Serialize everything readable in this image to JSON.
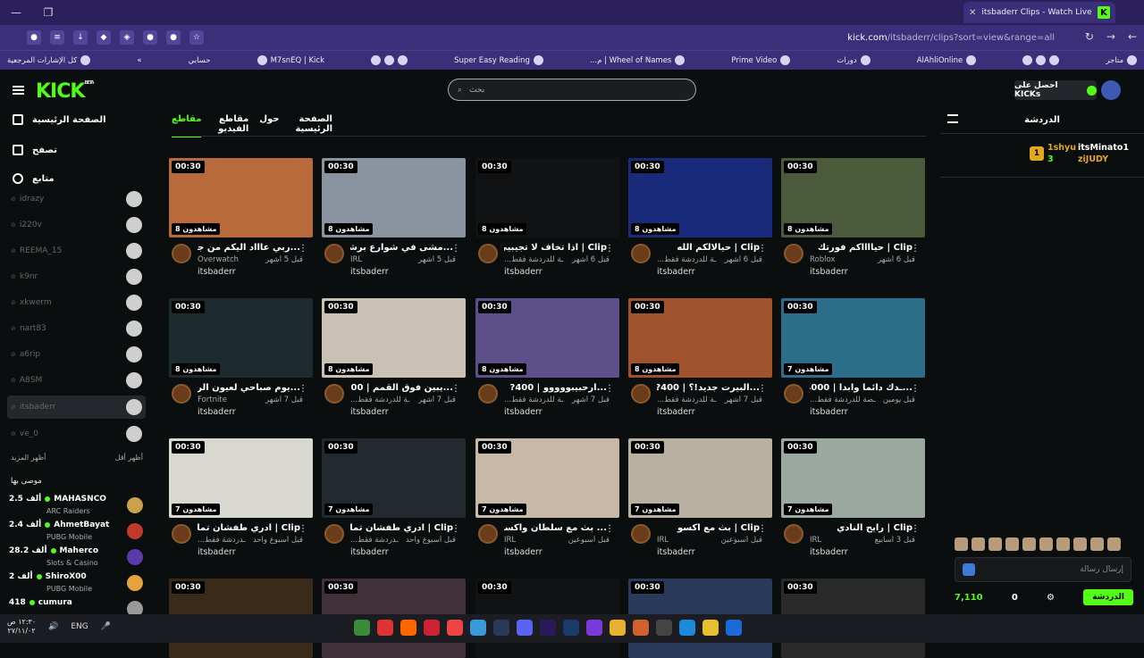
{
  "browser": {
    "tab_title": "itsbaderr Clips - Watch Live on",
    "url_main": "kick.com",
    "url_path": "/itsbaderr/clips?sort=view&range=all",
    "bookmarks": [
      "كل الإشارات المرجعية",
      "حسابي",
      "M7snEQ | Kick",
      "Super Easy Reading",
      "Wheel of Names | م...",
      "Prime Video",
      "دورات",
      "AlAhliOnline",
      "متاجر"
    ]
  },
  "header": {
    "search_placeholder": "بحث",
    "kicks_button": "احصل على KICKs",
    "logo": "KICK",
    "logo_beta": "BETA"
  },
  "sidebar": {
    "home": "الصفحة الرئيسية",
    "browse": "تصفح",
    "following": "متابع",
    "followed": [
      "idrazy",
      "i220v",
      "REEMA_15",
      "k9nr",
      "xkwerm",
      "nart83",
      "a6rip",
      "A8SM",
      "itsbaderr",
      "ve_0"
    ],
    "show_more": "أظهر المزيد",
    "show_less": "أظهر أقل",
    "recommended_title": "موصى بها",
    "recommended": [
      {
        "name": "MAHASNCO",
        "count": "2.5 ألف",
        "category": "ARC Raiders"
      },
      {
        "name": "AhmetBayat",
        "count": "2.4 ألف",
        "category": "PUBG Mobile"
      },
      {
        "name": "Maherco",
        "count": "28.2 ألف",
        "category": "Slots & Casino"
      },
      {
        "name": "ShiroX00",
        "count": "2 ألف",
        "category": "PUBG Mobile"
      },
      {
        "name": "cumura",
        "count": "418",
        "category": ""
      }
    ]
  },
  "channel_tabs": [
    "الصفحة الرئيسية",
    "حول",
    "مقاطع الفيديو",
    "مقاطع"
  ],
  "clips": [
    {
      "title": "...ربي عاااد اليكم من جديد",
      "duration": "00:30",
      "views": "مشاهدون 8",
      "category": "Overwatch",
      "age": "قبل 5 أشهر",
      "channel": "itsbaderr",
      "color": "#b86a3a"
    },
    {
      "title": "...مشى في شوارع برشلونة",
      "duration": "00:30",
      "views": "مشاهدون 8",
      "category": "IRL",
      "age": "قبل 5 أشهر",
      "channel": "itsbaderr",
      "color": "#8a94a0"
    },
    {
      "title": "Clip | اذا تخاف لا تجيبيي",
      "duration": "00:30",
      "views": "مشاهدون 8",
      "category": "...ـة للدردشة فقط",
      "age": "قبل 6 أشهر",
      "channel": "itsbaderr",
      "color": "#111214"
    },
    {
      "title": "Clip | حيالالكم الله",
      "duration": "00:30",
      "views": "مشاهدون 8",
      "category": "...ـة للدردشة فقط",
      "age": "قبل 6 أشهر",
      "channel": "itsbaderr",
      "color": "#1a2a7a"
    },
    {
      "title": "Clip | حيااااكم فورتك",
      "duration": "00:30",
      "views": "مشاهدون 8",
      "category": "Roblox",
      "age": "قبل 6 أشهر",
      "channel": "itsbaderr",
      "color": "#4a5a3a"
    },
    {
      "title": "...يوم صباحي لعيون الريكاند",
      "duration": "00:30",
      "views": "مشاهدون 8",
      "category": "Fortnite",
      "age": "قبل 7 أشهر",
      "channel": "itsbaderr",
      "color": "#1d2a2e"
    },
    {
      "title": "...يبين فوق القمم | 400?",
      "duration": "00:30",
      "views": "مشاهدون 8",
      "category": "...ـة للدردشة فقط",
      "age": "قبل 7 أشهر",
      "channel": "itsbaderr",
      "color": "#c9c2b4"
    },
    {
      "title": "...ارحبيبووووو | 400?",
      "duration": "00:30",
      "views": "مشاهدون 8",
      "category": "...ـة للدردشة فقط",
      "age": "قبل 7 أشهر",
      "channel": "itsbaderr",
      "color": "#5c4f8a"
    },
    {
      "title": "...البيرت جديد!؟ | 400?",
      "duration": "00:30",
      "views": "مشاهدون 8",
      "category": "...ـة للدردشة فقط",
      "age": "قبل 7 أشهر",
      "channel": "itsbaderr",
      "color": "#a0522d"
    },
    {
      "title": "...ـدك دائما وابدا | 4000?",
      "duration": "00:30",
      "views": "مشاهدون 7",
      "category": "...ـصة للدردشة فقط",
      "age": "قبل يومين",
      "channel": "itsbaderr",
      "color": "#2c6e8a"
    },
    {
      "title": "Clip | ادري طفشان تمال",
      "duration": "00:30",
      "views": "مشاهدون 7",
      "category": "...ـدردشة فقط",
      "age": "قبل أسبوع واحد",
      "channel": "itsbaderr",
      "color": "#d8d8d0"
    },
    {
      "title": "Clip | ادري طفشان تمال",
      "duration": "00:30",
      "views": "مشاهدون 7",
      "category": "...ـدردشة فقط",
      "age": "قبل أسبوع واحد",
      "channel": "itsbaderr",
      "color": "#222a30"
    },
    {
      "title": "... بث مع سلطان واكسو |",
      "duration": "00:30",
      "views": "مشاهدون 7",
      "category": "IRL",
      "age": "قبل أسبوعين",
      "channel": "itsbaderr",
      "color": "#c8b8a8"
    },
    {
      "title": "Clip | بث مع اكسو",
      "duration": "00:30",
      "views": "مشاهدون 7",
      "category": "IRL",
      "age": "قبل أسبوعين",
      "channel": "itsbaderr",
      "color": "#b8b0a0"
    },
    {
      "title": "Clip | رايح النادي",
      "duration": "00:30",
      "views": "مشاهدون 7",
      "category": "IRL",
      "age": "قبل 3 أسابيع",
      "channel": "itsbaderr",
      "color": "#9aa8a0"
    },
    {
      "title": "",
      "duration": "00:30",
      "views": "",
      "category": "",
      "age": "",
      "channel": "",
      "color": "#3a2a1a"
    },
    {
      "title": "",
      "duration": "00:30",
      "views": "",
      "category": "",
      "age": "",
      "channel": "",
      "color": "#40303a"
    },
    {
      "title": "",
      "duration": "00:30",
      "views": "",
      "category": "",
      "age": "",
      "channel": "",
      "color": "#111214"
    },
    {
      "title": "",
      "duration": "00:30",
      "views": "",
      "category": "",
      "age": "",
      "channel": "",
      "color": "#2a3a5a"
    },
    {
      "title": "",
      "duration": "00:30",
      "views": "",
      "category": "",
      "age": "",
      "channel": "",
      "color": "#2a2a2a"
    }
  ],
  "chat": {
    "title": "الدردشة",
    "gifters": [
      {
        "name": "itsMinato1",
        "count": "3"
      },
      {
        "name": "ziJUDY",
        "count": "2"
      },
      {
        "name": "1shyu",
        "count": "3"
      }
    ],
    "message_placeholder": "إرسال رسالة",
    "points": "7,110",
    "zero": "0",
    "chat_button": "الدردشة"
  },
  "taskbar": {
    "lang": "ENG",
    "time": "١٢:٣٠ ص",
    "date": "٢٧/١١/٠٢"
  }
}
